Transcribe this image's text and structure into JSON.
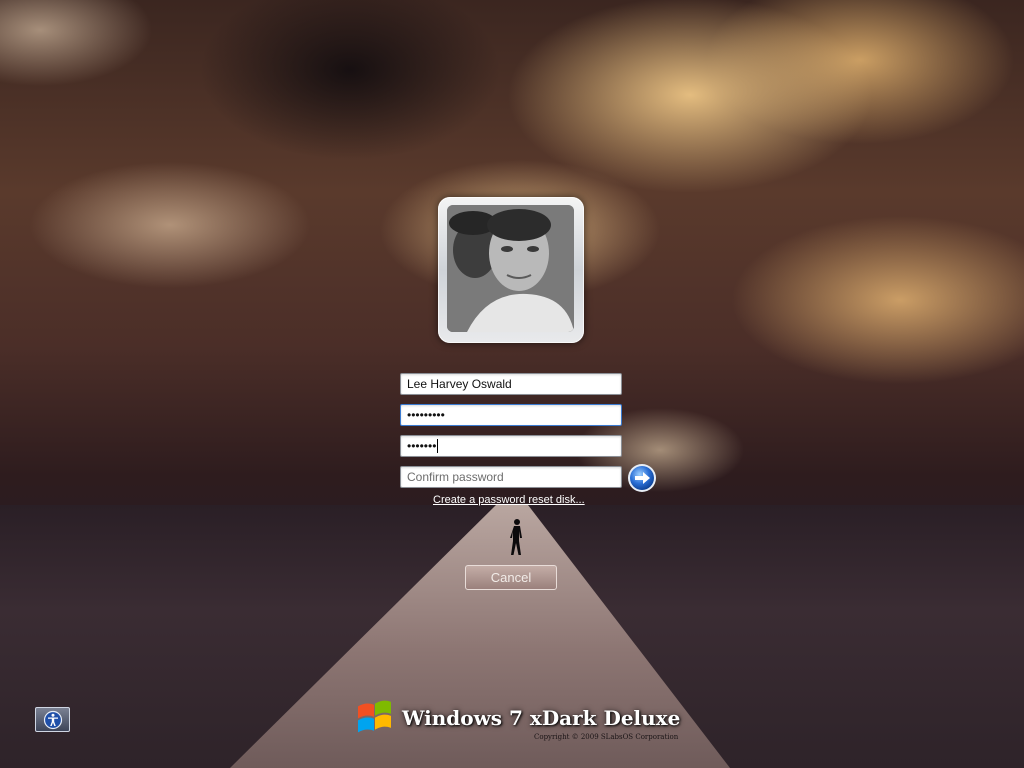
{
  "login": {
    "username": "Lee Harvey Oswald",
    "current_password_mask": "•••••••••",
    "new_password_mask": "•••••••",
    "confirm_placeholder": "Confirm password",
    "reset_link": "Create a password reset disk...",
    "cancel_label": "Cancel",
    "go_icon": "arrow-right-circle-icon"
  },
  "bottom": {
    "ease_of_access_icon": "ease-of-access-icon",
    "brand_name": "Windows 7 xDark Deluxe",
    "copyright": "Copyright © 2009 SLabsOS Corporation"
  },
  "colors": {
    "focus_border": "#3b7bd1",
    "go_button_blue": "#2a6fd6"
  }
}
